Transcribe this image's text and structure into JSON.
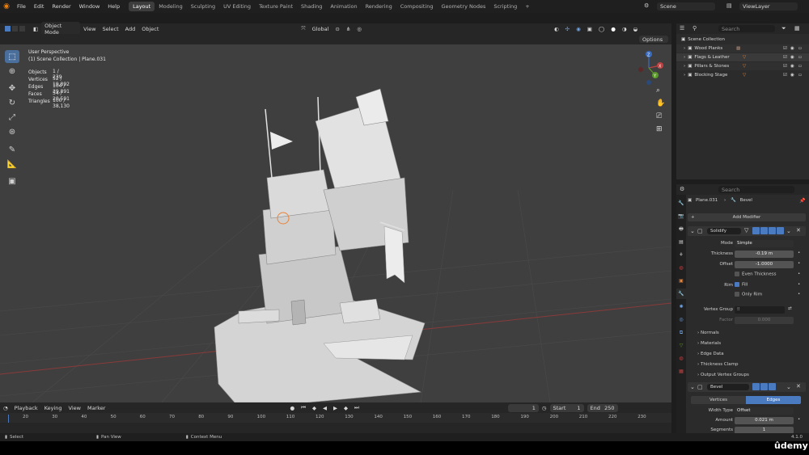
{
  "topbar": {
    "menus": [
      "File",
      "Edit",
      "Render",
      "Window",
      "Help"
    ],
    "workspaces": [
      "Layout",
      "Modeling",
      "Sculpting",
      "UV Editing",
      "Texture Paint",
      "Shading",
      "Animation",
      "Rendering",
      "Compositing",
      "Geometry Nodes",
      "Scripting"
    ],
    "active_workspace": "Layout",
    "add_workspace": "+",
    "scene": "Scene",
    "view_layer": "ViewLayer"
  },
  "viewport_header": {
    "mode": "Object Mode",
    "menus": [
      "View",
      "Select",
      "Add",
      "Object"
    ],
    "orientation": "Global",
    "options": "Options"
  },
  "overlay": {
    "view_name": "User Perspective",
    "collection": "(1) Scene Collection | Plane.031",
    "stats": [
      {
        "label": "Objects",
        "value": "1 / 239"
      },
      {
        "label": "Vertices",
        "value": "52 / 19,892"
      },
      {
        "label": "Edges",
        "value": "104 / 39,891"
      },
      {
        "label": "Faces",
        "value": "54 / 20,591"
      },
      {
        "label": "Triangles",
        "value": "100 / 38,130"
      }
    ]
  },
  "gizmo": {
    "x": "X",
    "y": "Y",
    "z": "Z"
  },
  "timeline": {
    "menus": [
      "Playback",
      "Keying",
      "View",
      "Marker"
    ],
    "current_frame": "1",
    "start_label": "Start",
    "start": "1",
    "end_label": "End",
    "end": "250",
    "ticks": [
      "20",
      "30",
      "40",
      "50",
      "60",
      "70",
      "80",
      "90",
      "100",
      "110",
      "120",
      "130",
      "140",
      "150",
      "160",
      "170",
      "180",
      "190",
      "200",
      "210",
      "220",
      "230"
    ]
  },
  "statusbar": {
    "select": "Select",
    "pan": "Pan View",
    "context": "Context Menu",
    "version": "4.1.0"
  },
  "outliner": {
    "search_placeholder": "Search",
    "root": "Scene Collection",
    "items": [
      {
        "label": "Wood Planks"
      },
      {
        "label": "Flags & Leather"
      },
      {
        "label": "Pillars & Stones"
      },
      {
        "label": "Blocking Stage"
      }
    ]
  },
  "properties": {
    "search_placeholder": "Search",
    "breadcrumb_object": "Plane.031",
    "breadcrumb_modifier": "Bevel",
    "add_modifier": "Add Modifier",
    "solidify": {
      "name": "Solidify",
      "mode_label": "Mode",
      "mode": "Simple",
      "thickness_label": "Thickness",
      "thickness": "-0.19 m",
      "offset_label": "Offset",
      "offset": "-1.0000",
      "even_thickness": "Even Thickness",
      "rim_label": "Rim",
      "fill": "Fill",
      "only_rim": "Only Rim",
      "vertex_group_label": "Vertex Group",
      "factor_label": "Factor",
      "factor": "0.000",
      "subpanels": [
        "Normals",
        "Materials",
        "Edge Data",
        "Thickness Clamp",
        "Output Vertex Groups"
      ]
    },
    "bevel": {
      "name": "Bevel",
      "tab_vertices": "Vertices",
      "tab_edges": "Edges",
      "width_type_label": "Width Type",
      "width_type": "Offset",
      "amount_label": "Amount",
      "amount": "0.021 m",
      "segments_label": "Segments",
      "segments": "1"
    }
  },
  "watermark": "ûdemy",
  "colors": {
    "accent": "#4a7ac0",
    "active_tool": "#4a6f9c",
    "blender_orange": "#e87d0d"
  }
}
